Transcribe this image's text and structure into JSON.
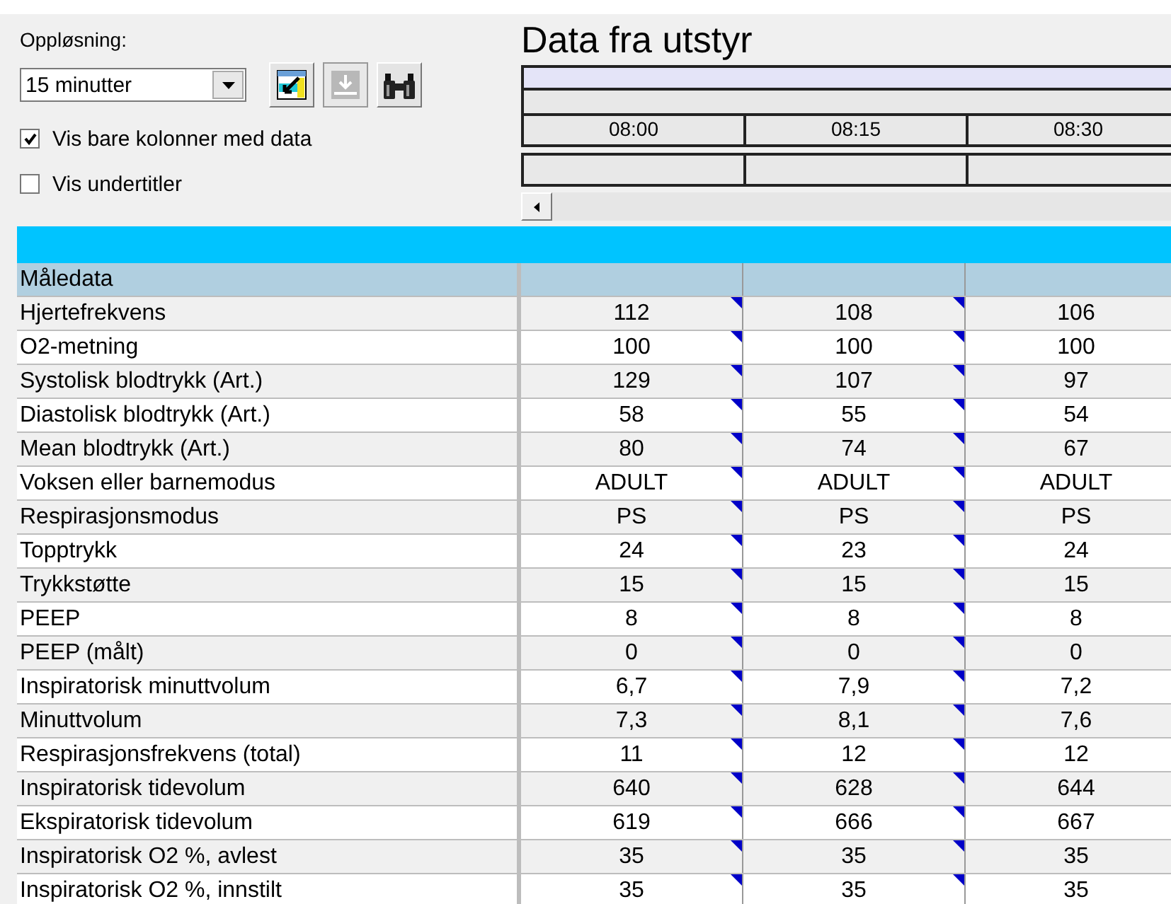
{
  "controls": {
    "resolution_label": "Oppløsning:",
    "resolution_value": "15 minutter",
    "checkboxes": [
      {
        "label": "Vis bare kolonner med data",
        "checked": true
      },
      {
        "label": "Vis undertitler",
        "checked": false
      }
    ]
  },
  "title": "Data fra utstyr",
  "times": [
    "08:00",
    "08:15",
    "08:30"
  ],
  "table": {
    "section": "Måledata",
    "rows": [
      {
        "label": "Hjertefrekvens",
        "cells": [
          "112",
          "108",
          "106"
        ]
      },
      {
        "label": "O2-metning",
        "cells": [
          "100",
          "100",
          "100"
        ]
      },
      {
        "label": "Systolisk blodtrykk (Art.)",
        "cells": [
          "129",
          "107",
          "97"
        ]
      },
      {
        "label": "Diastolisk blodtrykk (Art.)",
        "cells": [
          "58",
          "55",
          "54"
        ]
      },
      {
        "label": "Mean blodtrykk (Art.)",
        "cells": [
          "80",
          "74",
          "67"
        ]
      },
      {
        "label": "Voksen eller barnemodus",
        "cells": [
          "ADULT",
          "ADULT",
          "ADULT"
        ]
      },
      {
        "label": "Respirasjonsmodus",
        "cells": [
          "PS",
          "PS",
          "PS"
        ]
      },
      {
        "label": "Topptrykk",
        "cells": [
          "24",
          "23",
          "24"
        ]
      },
      {
        "label": "Trykkstøtte",
        "cells": [
          "15",
          "15",
          "15"
        ]
      },
      {
        "label": "PEEP",
        "cells": [
          "8",
          "8",
          "8"
        ]
      },
      {
        "label": "PEEP (målt)",
        "cells": [
          "0",
          "0",
          "0"
        ]
      },
      {
        "label": "Inspiratorisk minuttvolum",
        "cells": [
          "6,7",
          "7,9",
          "7,2"
        ]
      },
      {
        "label": "Minuttvolum",
        "cells": [
          "7,3",
          "8,1",
          "7,6"
        ]
      },
      {
        "label": "Respirasjonsfrekvens (total)",
        "cells": [
          "11",
          "12",
          "12"
        ]
      },
      {
        "label": "Inspiratorisk tidevolum",
        "cells": [
          "640",
          "628",
          "644"
        ]
      },
      {
        "label": "Ekspiratorisk tidevolum",
        "cells": [
          "619",
          "666",
          "667"
        ]
      },
      {
        "label": "Inspiratorisk O2 %, avlest",
        "cells": [
          "35",
          "35",
          "35"
        ]
      },
      {
        "label": "Inspiratorisk O2 %, innstilt",
        "cells": [
          "35",
          "35",
          "35"
        ]
      }
    ]
  }
}
